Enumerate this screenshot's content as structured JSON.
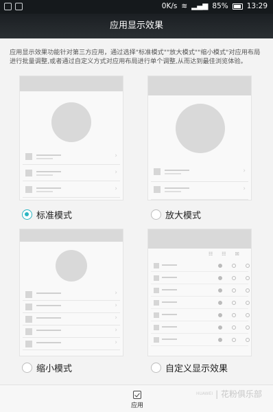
{
  "status": {
    "left_icons": [
      "photo-icon",
      "image-icon"
    ],
    "speed": "0K/s",
    "battery": "85%",
    "time": "13:29"
  },
  "header": {
    "title": "应用显示效果"
  },
  "description": "应用显示效果功能针对第三方应用，通过选择\"标准模式\"\"放大模式\"\"缩小模式\"对应用布局进行批量调整,或者通过自定义方式对应用布局进行单个调整,从而达到最佳浏览体验。",
  "options": [
    {
      "label": "标准模式",
      "selected": true
    },
    {
      "label": "放大模式",
      "selected": false
    },
    {
      "label": "缩小模式",
      "selected": false
    },
    {
      "label": "自定义显示效果",
      "selected": false
    }
  ],
  "bottom": {
    "apply_label": "应用"
  },
  "watermark": {
    "logo": "HUAWEI",
    "text": "| 花粉俱乐部"
  },
  "colors": {
    "accent": "#2ab5c2",
    "statusbar": "#15191c"
  }
}
